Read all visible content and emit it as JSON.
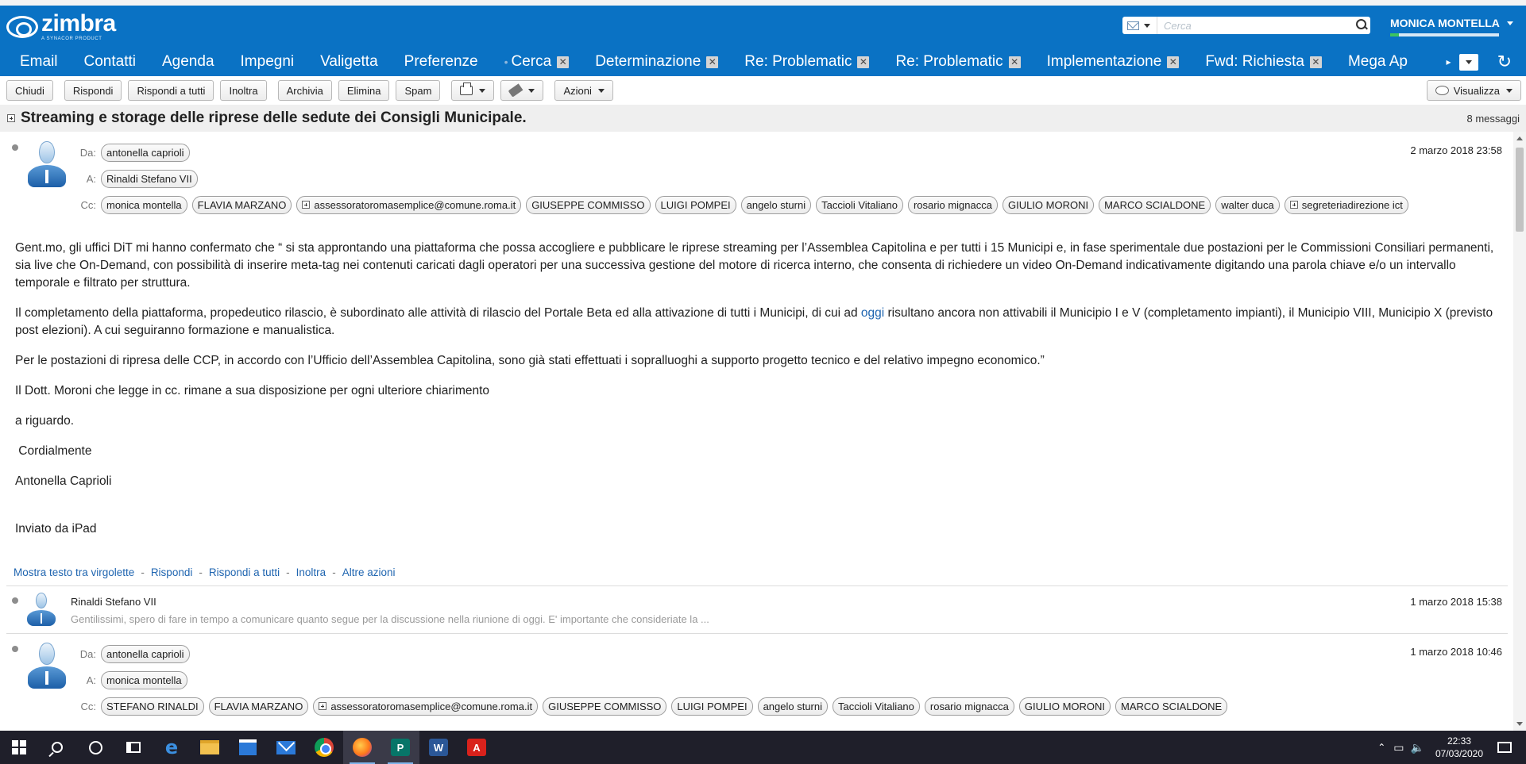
{
  "brand": {
    "name": "zimbra",
    "tagline": "A SYNACOR PRODUCT"
  },
  "search": {
    "placeholder": "Cerca"
  },
  "user": {
    "name": "MONICA MONTELLA",
    "quota_fraction": 0.08
  },
  "tabs": [
    {
      "label": "Email",
      "closable": false
    },
    {
      "label": "Contatti",
      "closable": false
    },
    {
      "label": "Agenda",
      "closable": false
    },
    {
      "label": "Impegni",
      "closable": false
    },
    {
      "label": "Valigetta",
      "closable": false
    },
    {
      "label": "Preferenze",
      "closable": false
    },
    {
      "label": "Cerca",
      "closable": true
    },
    {
      "label": "Determinazione",
      "closable": true
    },
    {
      "label": "Re: Problematic",
      "closable": true
    },
    {
      "label": "Re: Problematic",
      "closable": true
    },
    {
      "label": "Implementazione",
      "closable": true
    },
    {
      "label": "Fwd: Richiesta",
      "closable": true
    },
    {
      "label": "Mega Ap",
      "closable": false
    }
  ],
  "toolbar": {
    "close": "Chiudi",
    "reply": "Rispondi",
    "reply_all": "Rispondi a tutti",
    "forward": "Inoltra",
    "archive": "Archivia",
    "delete": "Elimina",
    "spam": "Spam",
    "actions": "Azioni",
    "view": "Visualizza"
  },
  "conversation": {
    "subject": "Streaming e storage delle riprese delle sedute dei Consigli Municipale.",
    "count": "8 messaggi"
  },
  "labels": {
    "from": "Da:",
    "to": "A:",
    "cc": "Cc:"
  },
  "message1": {
    "from": "antonella caprioli",
    "to": "Rinaldi Stefano VII",
    "cc": [
      "monica montella",
      "FLAVIA MARZANO",
      "assessoratoromasemplice@comune.roma.it",
      "GIUSEPPE COMMISSO",
      "LUIGI POMPEI",
      "angelo sturni",
      "Taccioli Vitaliano",
      "rosario mignacca",
      "GIULIO MORONI",
      "MARCO SCIALDONE",
      "walter duca",
      "segreteriadirezione ict"
    ],
    "date": "2 marzo 2018 23:58",
    "p1": "Gent.mo, gli uffici DiT mi hanno  confermato che “ si sta approntando una piattaforma che possa accogliere e pubblicare le riprese streaming per l’Assemblea Capitolina e per tutti i 15 Municipi e, in fase sperimentale due postazioni per le Commissioni Consiliari permanenti, sia live che On-Demand, con possibilità di inserire meta-tag nei contenuti caricati dagli operatori per una successiva gestione del motore di ricerca interno, che consenta di richiedere un video On-Demand indicativamente digitando una parola chiave e/o un intervallo temporale e filtrato per struttura.",
    "p2_before": "Il completamento della piattaforma, propedeutico rilascio, è subordinato alle attività di rilascio del Portale Beta ed alla attivazione di tutti i Municipi, di cui ad ",
    "p2_link": "oggi",
    "p2_after": " risultano ancora non attivabili il Municipio I e V (completamento impianti), il Municipio VIII, Municipio X (previsto post elezioni). A cui seguiranno formazione e manualistica.",
    "p3": "Per le postazioni di ripresa delle CCP, in accordo con l’Ufficio dell’Assemblea Capitolina, sono già stati effettuati i sopralluoghi a supporto progetto tecnico e del relativo impegno economico.”",
    "p4": "Il Dott. Moroni che legge in cc. rimane a sua disposizione per ogni ulteriore chiarimento",
    "p5": "a riguardo.",
    "p6": " Cordialmente",
    "p7": "Antonella Caprioli",
    "p8": "Inviato da iPad",
    "actions": {
      "quoted": "Mostra testo tra virgolette",
      "reply": "Rispondi",
      "reply_all": "Rispondi a tutti",
      "forward": "Inoltra",
      "more": "Altre azioni"
    }
  },
  "message2": {
    "from": "Rinaldi Stefano VII",
    "date": "1 marzo 2018 15:38",
    "snippet": "Gentilissimi, spero di fare in tempo a comunicare quanto segue per la discussione nella riunione di oggi. E' importante che consideriate la ..."
  },
  "message3": {
    "from": "antonella caprioli",
    "to": "monica montella",
    "cc": [
      "STEFANO RINALDI",
      "FLAVIA MARZANO",
      "assessoratoromasemplice@comune.roma.it",
      "GIUSEPPE COMMISSO",
      "LUIGI POMPEI",
      "angelo sturni",
      "Taccioli Vitaliano",
      "rosario mignacca",
      "GIULIO MORONI",
      "MARCO SCIALDONE"
    ],
    "date": "1 marzo 2018 10:46"
  },
  "taskbar": {
    "time": "22:33",
    "date": "07/03/2020",
    "apps": [
      "start",
      "search",
      "cortana",
      "task-view",
      "edge",
      "file-explorer",
      "store",
      "mail",
      "chrome",
      "firefox",
      "publisher",
      "word",
      "acrobat"
    ]
  },
  "colors": {
    "header_blue": "#0a72c4",
    "link_blue": "#1f65b0",
    "quota_green": "#3cc460",
    "taskbar": "#1f1f2a"
  }
}
